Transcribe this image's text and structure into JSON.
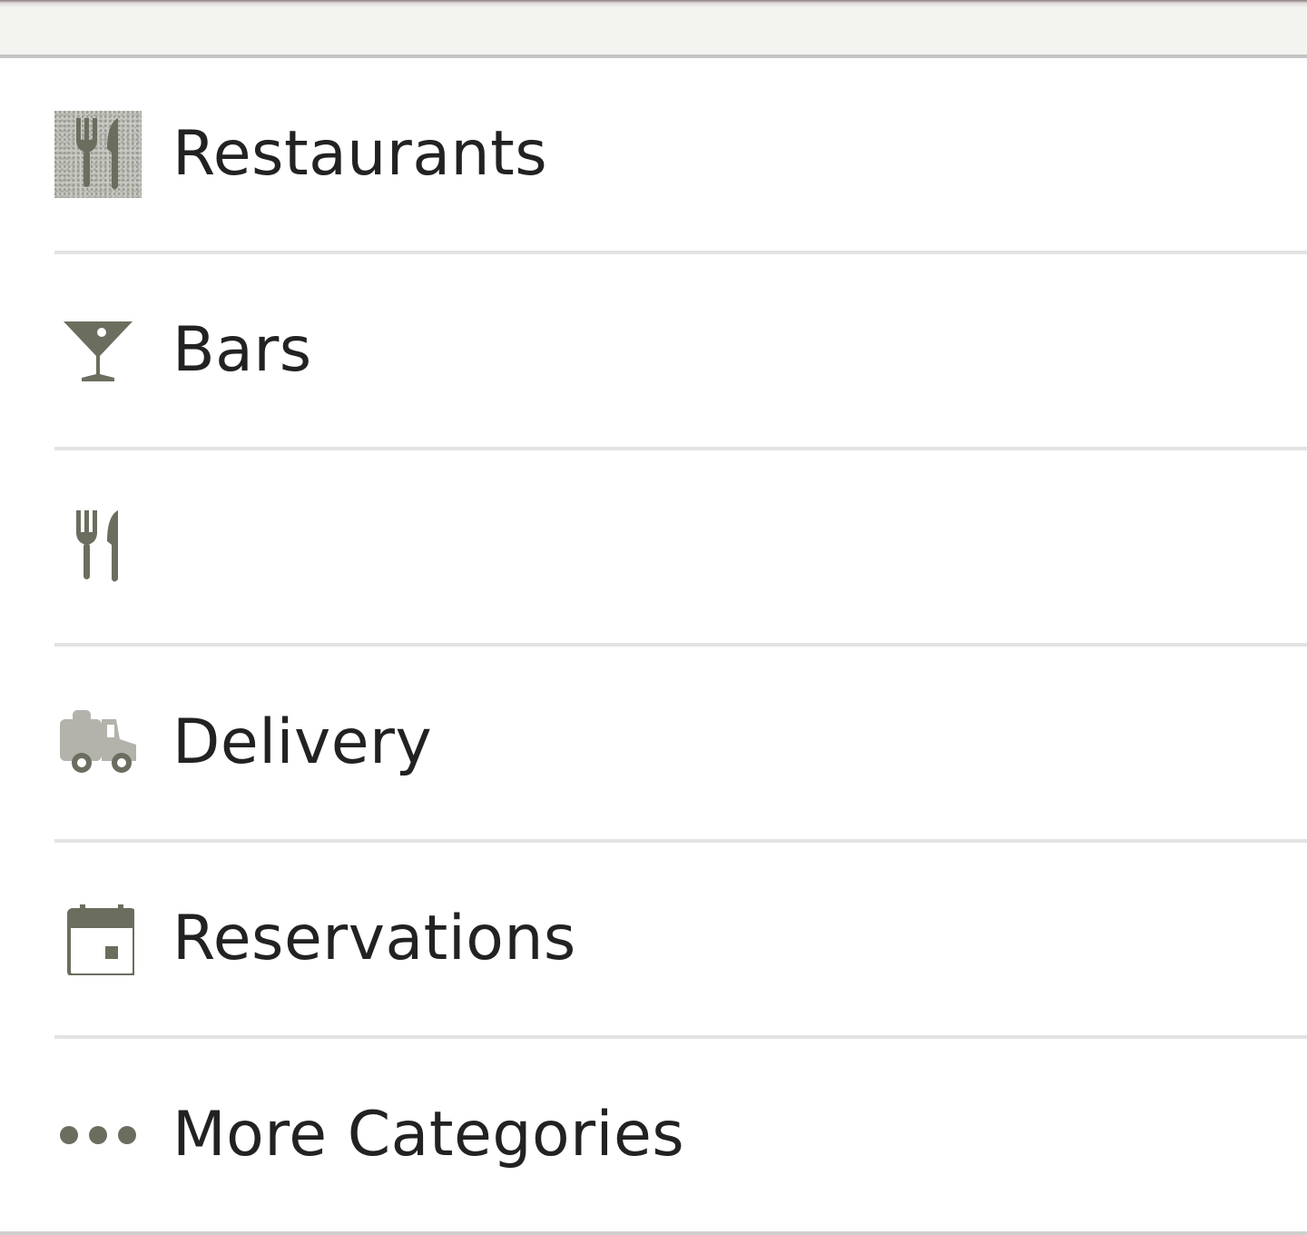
{
  "colors": {
    "icon": "#6b6e5f",
    "delivery_icon": "#b3b3ac",
    "text": "#222222",
    "divider": "#e3e3e3",
    "top_bar": "#f3f3f0"
  },
  "categories": [
    {
      "label": "Restaurants",
      "icon": "fork-knife-icon"
    },
    {
      "label": "Bars",
      "icon": "cocktail-icon"
    },
    {
      "label": "",
      "icon": "fork-knife-icon"
    },
    {
      "label": "Delivery",
      "icon": "delivery-truck-icon"
    },
    {
      "label": "Reservations",
      "icon": "calendar-icon"
    },
    {
      "label": "More Categories",
      "icon": "more-dots-icon"
    }
  ]
}
